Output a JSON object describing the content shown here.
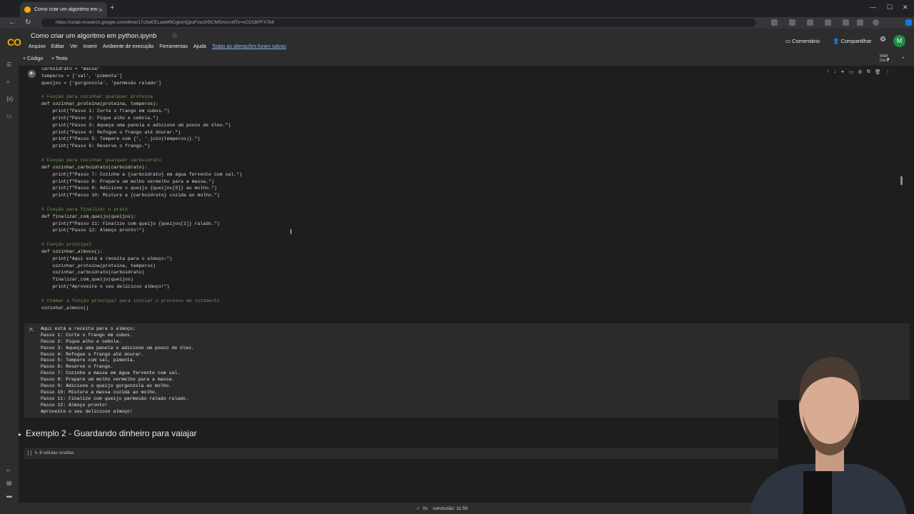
{
  "browser": {
    "tab_title": "Como criar um algoritmo em python.ipynb - Colab",
    "url": "https://colab.research.google.com/drive/17cSeEELawbf9CgkxnQpuFcw1H5CMS#scrollTo=xCO1BPFXTe8"
  },
  "colab": {
    "logo": "CO",
    "title": "Como criar um algoritmo em python.ipynb",
    "menus": [
      "Arquivo",
      "Editar",
      "Ver",
      "Inserir",
      "Ambiente de execução",
      "Ferramentas",
      "Ajuda"
    ],
    "saved": "Todas as alterações foram salvas",
    "comment": "Comentário",
    "share": "Compartilhar",
    "avatar": "M"
  },
  "toolbar": {
    "code_btn": "+ Código",
    "text_btn": "+ Texto",
    "ram": "RAM",
    "disk": "Disco"
  },
  "code_lines": [
    "carboidrato = 'massa'",
    "temperos = ['sal', 'pimenta']",
    "queijos = ['gorgonzola', 'parmesão ralado']",
    "",
    "# Função para cozinhar qualquer proteína",
    "def cozinhar_proteina(proteina, temperos):",
    "    print(\"Passo 1: Corte o frango em cubos.\")",
    "    print(\"Passo 2: Pique alho e cebola.\")",
    "    print(\"Passo 3: Aqueça uma panela e adicione um pouco de óleo.\")",
    "    print(\"Passo 4: Refogue o frango até dourar.\")",
    "    print(f\"Passo 5: Tempere com {', '.join(temperos)}.\")",
    "    print(\"Passo 6: Reserve o frango.\")",
    "",
    "# Função para cozinhar qualquer carboidrato",
    "def cozinhar_carboidrato(carboidrato):",
    "    print(f\"Passo 7: Cozinhe a {carboidrato} em água fervente com sal.\")",
    "    print(f\"Passo 8: Prepare um molho vermelho para a massa.\")",
    "    print(f\"Passo 9: Adicione o queijo {queijos[0]} ao molho.\")",
    "    print(f\"Passo 10: Misture a {carboidrato} cozida ao molho.\")",
    "",
    "# Função para finalizar o prato",
    "def finalizar_com_queijo(queijos):",
    "    print(f\"Passo 11: Finalize com queijo {queijos[1]} ralado.\")",
    "    print(\"Passo 12: Almoço pronto!\")",
    "",
    "# Função principal",
    "def cozinhar_almoco():",
    "    print(\"Aqui está a receita para o almoço:\")",
    "    cozinhar_proteina(proteina, temperos)",
    "    cozinhar_carboidrato(carboidrato)",
    "    finalizar_com_queijo(queijos)",
    "    print(\"Aproveite o seu delicioso almoço!\")",
    "",
    "# Chamar a função principal para iniciar o processo de cozimento",
    "cozinhar_almoco()"
  ],
  "output_lines": [
    "Aqui está a receita para o almoço:",
    "Passo 1: Corte o frango em cubos.",
    "Passo 2: Pique alho e cebola.",
    "Passo 3: Aqueça uma panela e adicione um pouco de óleo.",
    "Passo 4: Refogue o frango até dourar.",
    "Passo 5: Tempere com sal, pimenta.",
    "Passo 6: Reserve o frango.",
    "Passo 7: Cozinhe a massa em água fervente com sal.",
    "Passo 8: Prepare um molho vermelho para a massa.",
    "Passo 9: Adicione o queijo gorgonzola ao molho.",
    "Passo 10: Misture a massa cozida ao molho.",
    "Passo 11: Finalize com queijo parmesão ralado ralado.",
    "Passo 12: Almoço pronto!",
    "Aproveite o seu delicioso almoço!"
  ],
  "section": {
    "title": "Exemplo 2 - Guardando dinheiro para vaiajar"
  },
  "hidden": {
    "label": "[ ]  ↳ 8 células ocultas"
  },
  "status": {
    "text": "✓  0s    conclusão: 11:59"
  }
}
